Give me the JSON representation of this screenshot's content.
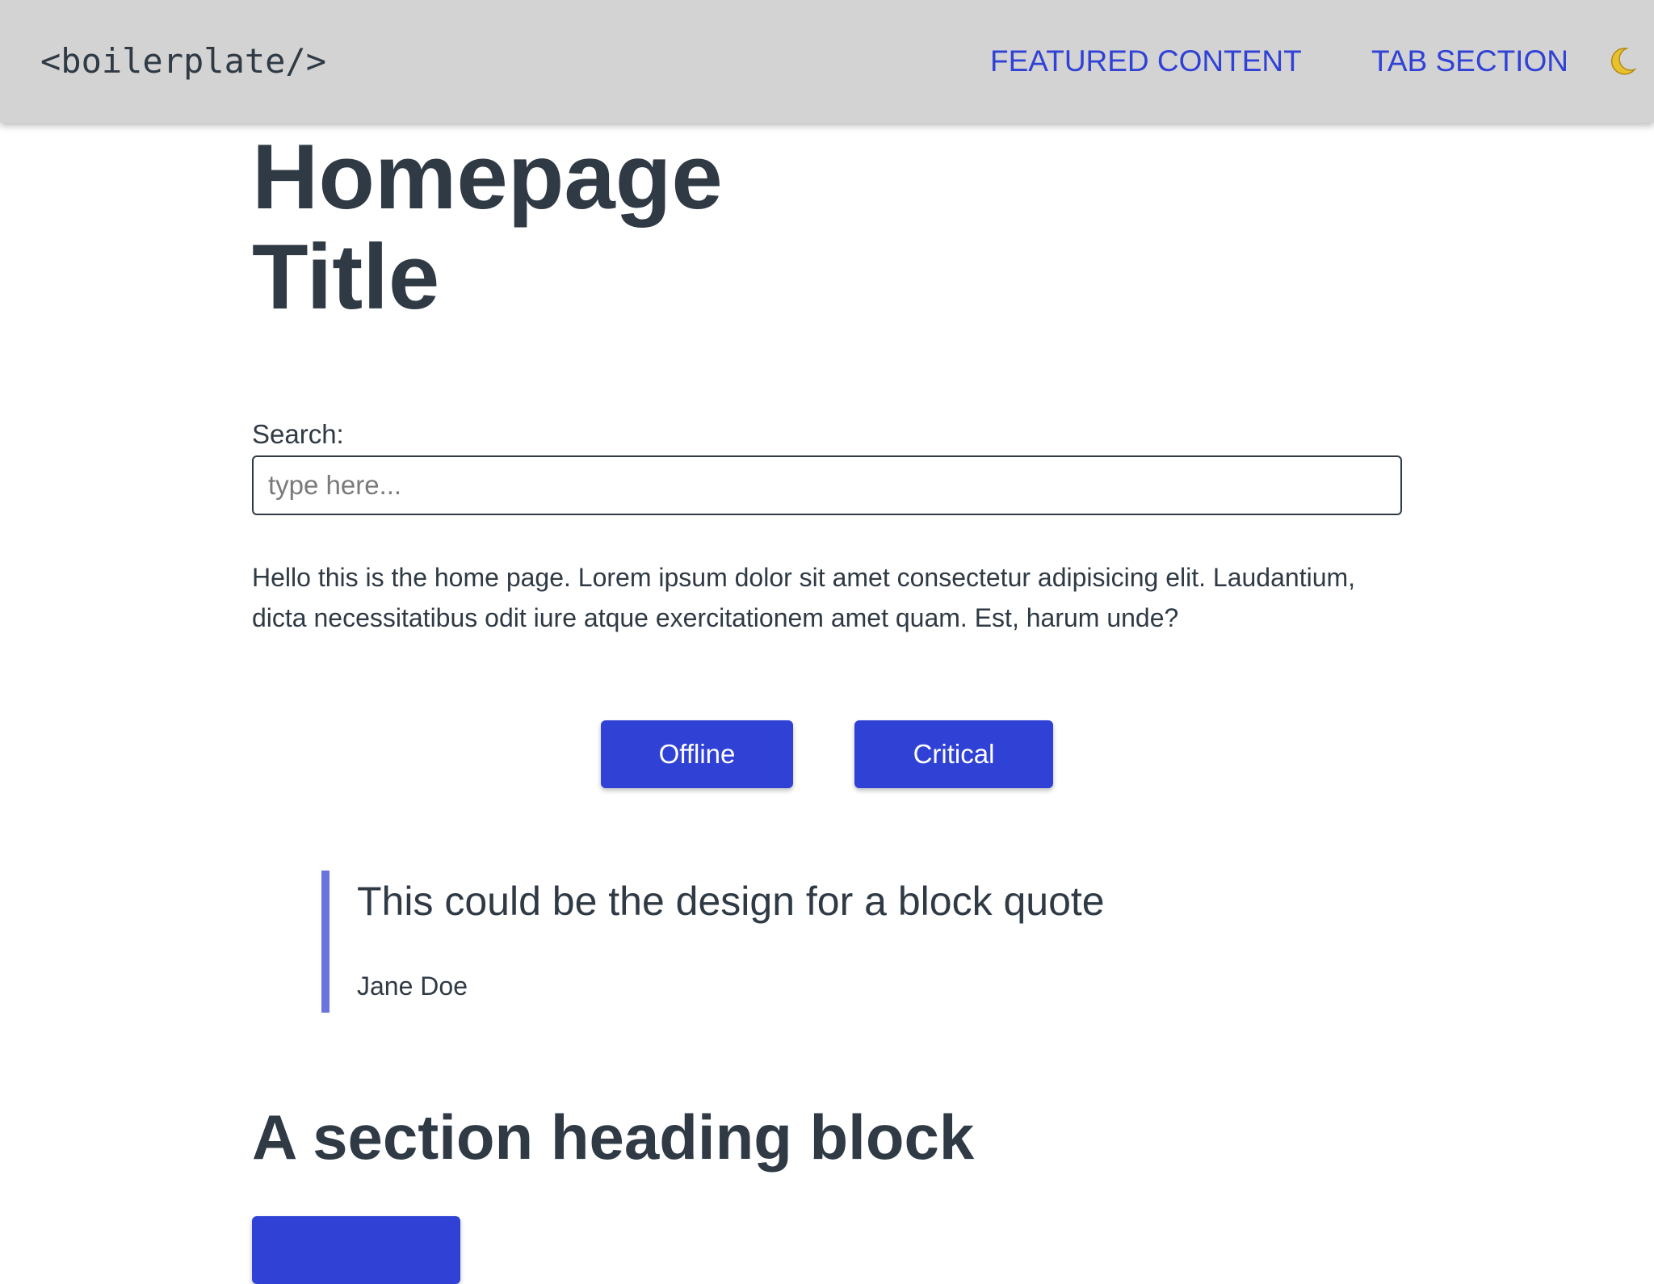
{
  "header": {
    "logo": "<boilerplate/>",
    "nav": {
      "featured": "FEATURED CONTENT",
      "tabs": "TAB SECTION"
    },
    "theme_icon": "moon-icon"
  },
  "main": {
    "title": "Homepage Title",
    "search": {
      "label": "Search:",
      "placeholder": "type here...",
      "value": ""
    },
    "intro": "Hello this is the home page. Lorem ipsum dolor sit amet consectetur adipisicing elit. Laudantium, dicta necessitatibus odit iure atque exercitationem amet quam. Est, harum unde?",
    "buttons": {
      "offline": "Offline",
      "critical": "Critical"
    },
    "quote": {
      "text": "This could be the design for a block quote",
      "author": "Jane Doe"
    },
    "section": {
      "heading": "A section heading block"
    }
  },
  "colors": {
    "header_bg": "#d3d3d3",
    "accent": "#3041d6",
    "quote_bar": "#6b73dc",
    "text": "#2f3a45"
  }
}
